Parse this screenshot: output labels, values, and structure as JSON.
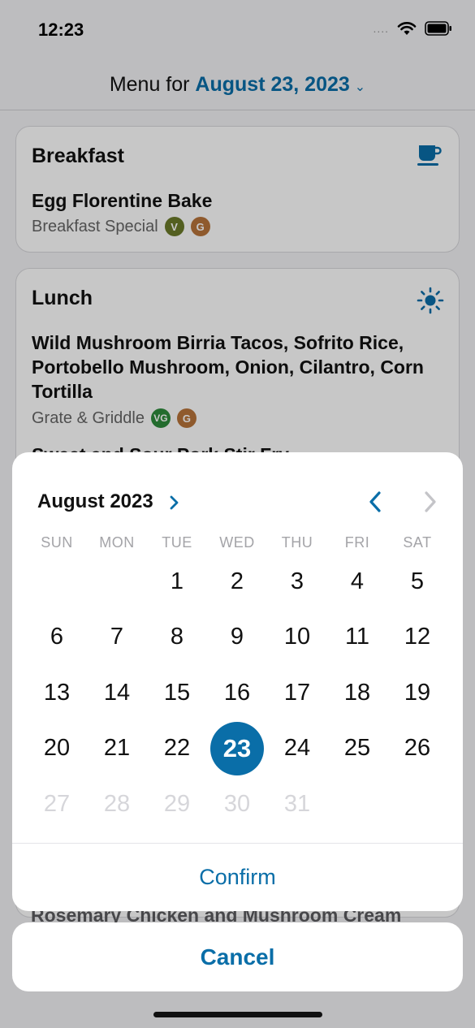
{
  "status": {
    "time": "12:23",
    "signal": "....",
    "wifi_icon": "wifi-icon",
    "battery_icon": "battery-icon"
  },
  "header": {
    "prefix": "Menu for ",
    "date": "August 23, 2023"
  },
  "breakfast": {
    "title": "Breakfast",
    "icon": "coffee-cup-icon",
    "item": {
      "name": "Egg Florentine Bake",
      "station": "Breakfast Special",
      "badges": [
        "V",
        "G"
      ]
    }
  },
  "lunch": {
    "title": "Lunch",
    "icon": "sun-icon",
    "item": {
      "name": "Wild Mushroom Birria Tacos, Sofrito Rice, Portobello Mushroom, Onion, Cilantro, Corn Tortilla",
      "station": "Grate & Griddle",
      "badges": [
        "VG",
        "G"
      ]
    },
    "next_item": "Sweet and Sour Pork Stir Fry"
  },
  "peek_item": "Rosemary Chicken and Mushroom Cream",
  "picker": {
    "month": "August 2023",
    "weekdays": [
      "SUN",
      "MON",
      "TUE",
      "WED",
      "THU",
      "FRI",
      "SAT"
    ],
    "selected_day": "23",
    "confirm_label": "Confirm",
    "cancel_label": "Cancel"
  },
  "colors": {
    "accent": "#0a6ea8",
    "vegetarian": "#6b7a2a",
    "vegan": "#2e8b3c",
    "gluten": "#b8743a"
  }
}
